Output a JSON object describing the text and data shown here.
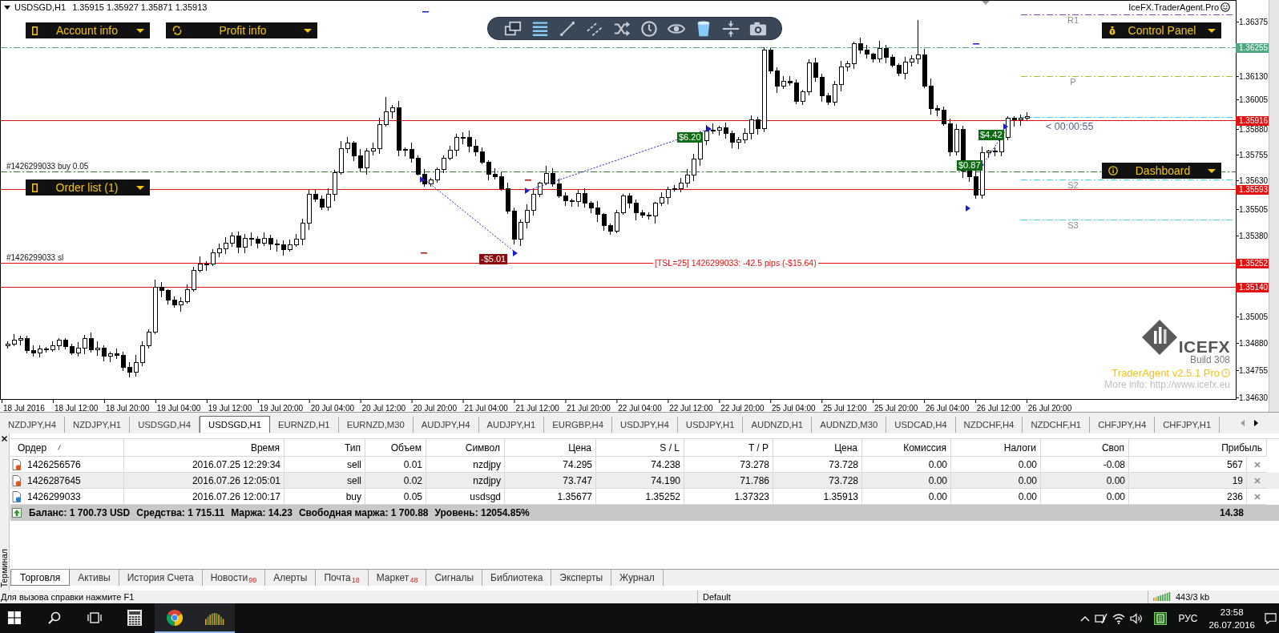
{
  "chart": {
    "symbol": "USDSGD,H1",
    "quotes": "1.35915 1.35927 1.35871 1.35913",
    "brand": "IceFX.TraderAgent.Pro",
    "panels": [
      {
        "kind": "account",
        "label": "Account info"
      },
      {
        "kind": "profit",
        "label": "Profit info"
      },
      {
        "kind": "control",
        "label": "Control Panel"
      },
      {
        "kind": "dashboard",
        "label": "Dashboard"
      },
      {
        "kind": "orders",
        "label": "Order list (1)"
      }
    ],
    "tools": [
      {
        "kind": "windows",
        "on": false
      },
      {
        "kind": "menu",
        "on": true
      },
      {
        "kind": "line",
        "on": false
      },
      {
        "kind": "channel",
        "on": false
      },
      {
        "kind": "shuffle",
        "on": false
      },
      {
        "kind": "clock",
        "on": false
      },
      {
        "kind": "eye",
        "on": false
      },
      {
        "kind": "bucket",
        "on": true
      },
      {
        "kind": "resize",
        "on": false
      },
      {
        "kind": "camera",
        "on": false
      }
    ],
    "pivots": [
      {
        "label": "R1",
        "color": "#8e44ad"
      },
      {
        "label": "P",
        "color": "#b3bc3a"
      },
      {
        "color": "#3fd3e6"
      },
      {
        "label": "S2",
        "color": "#3fd3e6"
      },
      {
        "label": "S3",
        "color": "#3fd3e6"
      }
    ],
    "lines": [
      {
        "kind": "dashdot",
        "color": "#4fa882",
        "tag": "1.36255"
      },
      {
        "kind": "solid",
        "color": "#e31010",
        "tag": "1.35916"
      },
      {
        "kind": "dashdot",
        "color": "#2f7a2f",
        "note": "#1426299033 buy 0.05"
      },
      {
        "kind": "solid",
        "color": "#e31010",
        "tag": "1.35593"
      },
      {
        "kind": "solid",
        "color": "#e31010",
        "tag": "1.35252",
        "note": "#1426299033 sl",
        "caption": "[TSL=25] 1426299033: -42.5 pips (-$15.64)"
      },
      {
        "kind": "solid",
        "color": "#e31010",
        "tag": "1.35140"
      }
    ],
    "trades": [
      {
        "kind": "profit",
        "text": "$6.20"
      },
      {
        "kind": "profit",
        "text": "$4.42"
      },
      {
        "kind": "profit",
        "text": "$0.87"
      },
      {
        "kind": "loss",
        "text": "-$5.01"
      }
    ],
    "countdown": "< 00:00:55",
    "price_ticks": [
      "1.36375",
      "1.36130",
      "1.36005",
      "1.35880",
      "1.35755",
      "1.35630",
      "1.35505",
      "1.35380",
      "1.35005",
      "1.34880",
      "1.34755",
      "1.34630"
    ],
    "time_ticks": [
      "18 Jul 2016",
      "18 Jul 12:00",
      "18 Jul 20:00",
      "19 Jul 04:00",
      "19 Jul 12:00",
      "19 Jul 20:00",
      "20 Jul 04:00",
      "20 Jul 12:00",
      "20 Jul 20:00",
      "21 Jul 04:00",
      "21 Jul 12:00",
      "21 Jul 20:00",
      "22 Jul 04:00",
      "22 Jul 12:00",
      "22 Jul 20:00",
      "25 Jul 04:00",
      "25 Jul 12:00",
      "25 Jul 20:00",
      "26 Jul 04:00",
      "26 Jul 12:00",
      "26 Jul 20:00"
    ],
    "logo": {
      "name": "ICEFX",
      "build": "Build 308",
      "product": "TraderAgent v2.5.1 Pro",
      "info": "More info: http://www.icefx.eu"
    }
  },
  "chart_tabs": [
    {
      "label": "NZDJPY,H4",
      "selected": false
    },
    {
      "label": "NZDJPY,H1",
      "selected": false
    },
    {
      "label": "USDSGD,H4",
      "selected": false
    },
    {
      "label": "USDSGD,H1",
      "selected": true
    },
    {
      "label": "EURNZD,H1",
      "selected": false
    },
    {
      "label": "EURNZD,M30",
      "selected": false
    },
    {
      "label": "AUDJPY,H4",
      "selected": false
    },
    {
      "label": "AUDJPY,H1",
      "selected": false
    },
    {
      "label": "EURGBP,H4",
      "selected": false
    },
    {
      "label": "USDJPY,H4",
      "selected": false
    },
    {
      "label": "USDJPY,H1",
      "selected": false
    },
    {
      "label": "AUDNZD,H1",
      "selected": false
    },
    {
      "label": "AUDNZD,M30",
      "selected": false
    },
    {
      "label": "USDCAD,H4",
      "selected": false
    },
    {
      "label": "NZDCHF,H4",
      "selected": false
    },
    {
      "label": "NZDCHF,H1",
      "selected": false
    },
    {
      "label": "CHFJPY,H4",
      "selected": false
    },
    {
      "label": "CHFJPY,H1",
      "selected": false
    }
  ],
  "terminal": {
    "title": "Терминал",
    "columns": [
      "Ордер",
      "Время",
      "Тип",
      "Объем",
      "Символ",
      "Цена",
      "S / L",
      "T / P",
      "Цена",
      "Комиссия",
      "Налоги",
      "Своп",
      "Прибыль"
    ],
    "rows": [
      {
        "kind": "sell",
        "cells": [
          "1426256576",
          "2016.07.25 12:29:34",
          "sell",
          "0.01",
          "nzdjpy",
          "74.295",
          "74.238",
          "73.278",
          "73.728",
          "0.00",
          "0.00",
          "-0.08",
          "567"
        ]
      },
      {
        "kind": "sell",
        "cells": [
          "1426287645",
          "2016.07.26 12:05:01",
          "sell",
          "0.02",
          "nzdjpy",
          "73.747",
          "74.190",
          "71.786",
          "73.728",
          "0.00",
          "0.00",
          "0.00",
          "19"
        ]
      },
      {
        "kind": "buy",
        "cells": [
          "1426299033",
          "2016.07.26 12:00:17",
          "buy",
          "0.05",
          "usdsgd",
          "1.35677",
          "1.35252",
          "1.37323",
          "1.35913",
          "0.00",
          "0.00",
          "0.00",
          "236"
        ]
      }
    ],
    "summary": {
      "items": [
        "Баланс: 1 700.73 USD",
        "Средства: 1 715.11",
        "Маржа: 14.23",
        "Свободная маржа: 1 700.88",
        "Уровень: 12054.85%"
      ],
      "profit": "14.38"
    },
    "tabs": [
      {
        "label": "Торговля",
        "selected": true
      },
      {
        "label": "Активы",
        "selected": false
      },
      {
        "label": "История Счета",
        "selected": false
      },
      {
        "label": "Новости",
        "badge": "99",
        "selected": false
      },
      {
        "label": "Алерты",
        "selected": false
      },
      {
        "label": "Почта",
        "badge": "18",
        "selected": false
      },
      {
        "label": "Маркет",
        "badge": "48",
        "selected": false
      },
      {
        "label": "Сигналы",
        "selected": false
      },
      {
        "label": "Библиотека",
        "selected": false
      },
      {
        "label": "Эксперты",
        "selected": false
      },
      {
        "label": "Журнал",
        "selected": false
      }
    ]
  },
  "status_bar": {
    "help": "Для вызова справки нажмите F1",
    "profile": "Default",
    "traffic": "443/3 kb"
  },
  "taskbar": {
    "apps": [
      {
        "kind": "calculator",
        "running": false
      },
      {
        "kind": "browser",
        "running": true
      },
      {
        "kind": "terminal",
        "running": true
      }
    ],
    "language": "РУС",
    "time": "23:58",
    "date": "26.07.2016"
  }
}
